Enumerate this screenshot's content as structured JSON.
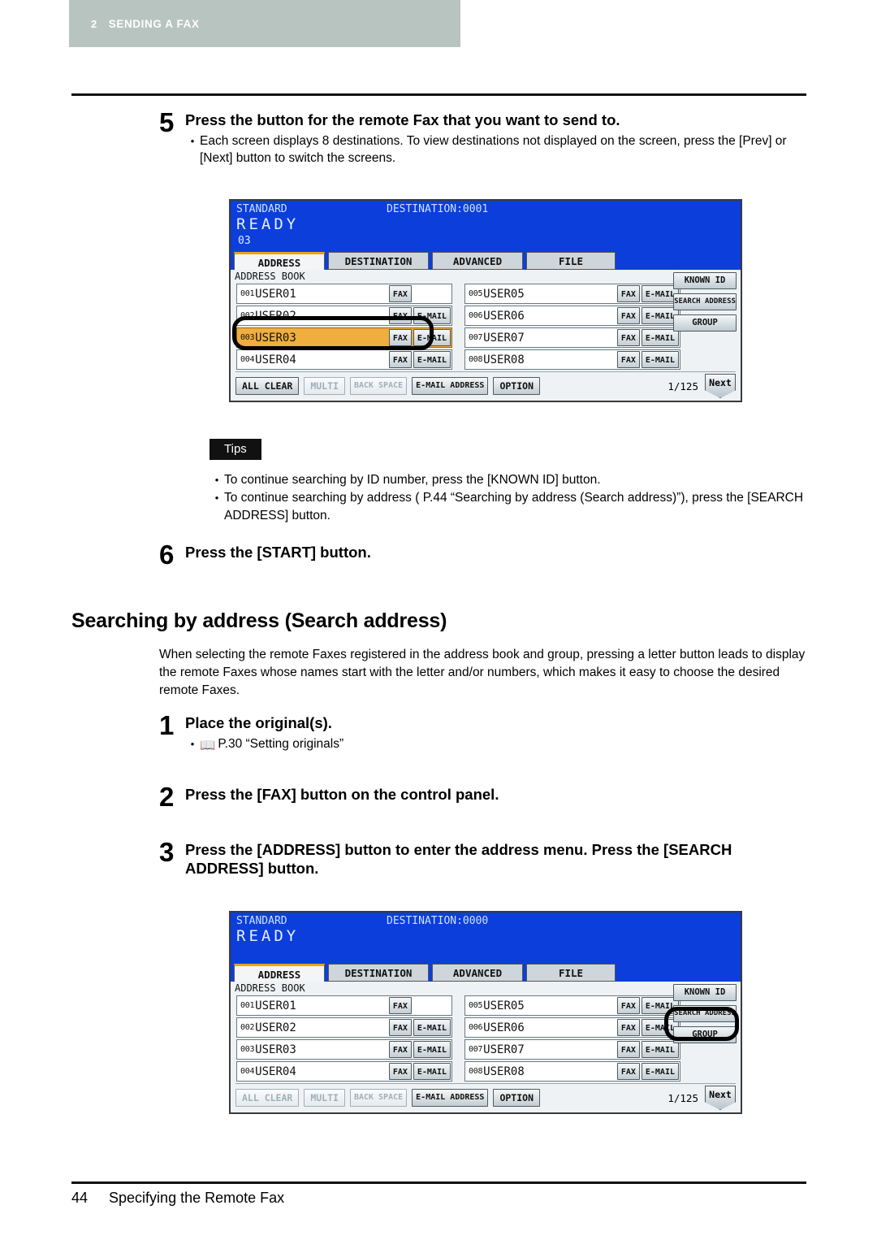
{
  "chapter": {
    "number": "2",
    "title": "SENDING A FAX"
  },
  "footer": {
    "page_number": "44",
    "text": "Specifying the Remote Fax"
  },
  "steps": {
    "step5": {
      "number": "5",
      "title": "Press the button for the remote Fax that you want to send to.",
      "bullet": "Each screen displays 8 destinations. To view destinations not displayed on the screen, press the [Prev] or [Next] button to switch the screens."
    },
    "step6": {
      "number": "6",
      "title": "Press the [START] button."
    },
    "step1": {
      "number": "1",
      "title": "Place the original(s).",
      "bullet": "P.30 “Setting originals”"
    },
    "step2": {
      "number": "2",
      "title": "Press the [FAX] button on the control panel."
    },
    "step3": {
      "number": "3",
      "title": "Press the [ADDRESS] button to enter the address menu. Press the [SEARCH ADDRESS] button."
    }
  },
  "tips": {
    "label": "Tips",
    "items": [
      "To continue searching by ID number, press the [KNOWN ID] button.",
      "To continue searching by address ( P.44 “Searching by address (Search address)”), press the [SEARCH ADDRESS] button."
    ]
  },
  "section": {
    "heading": "Searching by address (Search address)",
    "paragraph": "When selecting the remote Faxes registered in the address book and group, pressing a letter button leads to display the remote Faxes whose names start with the letter and/or numbers, which makes it easy to choose the desired remote Faxes."
  },
  "lcd1": {
    "status_mode": "STANDARD",
    "destination": "DESTINATION:0001",
    "ready": "READY",
    "sub_line": "03",
    "tabs": [
      "ADDRESS",
      "DESTINATION",
      "ADVANCED",
      "FILE"
    ],
    "active_tab": "ADDRESS",
    "address_book_label": "ADDRESS BOOK",
    "left_rows": [
      {
        "id": "001",
        "name": "USER01",
        "fax": "FAX",
        "email": ""
      },
      {
        "id": "002",
        "name": "USER02",
        "fax": "FAX",
        "email": "E-MAIL"
      },
      {
        "id": "003",
        "name": "USER03",
        "fax": "FAX",
        "email": "E-MAIL"
      },
      {
        "id": "004",
        "name": "USER04",
        "fax": "FAX",
        "email": "E-MAIL"
      }
    ],
    "right_rows": [
      {
        "id": "005",
        "name": "USER05",
        "fax": "FAX",
        "email": "E-MAIL"
      },
      {
        "id": "006",
        "name": "USER06",
        "fax": "FAX",
        "email": "E-MAIL"
      },
      {
        "id": "007",
        "name": "USER07",
        "fax": "FAX",
        "email": "E-MAIL"
      },
      {
        "id": "008",
        "name": "USER08",
        "fax": "FAX",
        "email": "E-MAIL"
      }
    ],
    "selected_row_index": 2,
    "side_buttons": [
      "KNOWN ID",
      "SEARCH ADDRESS",
      "GROUP"
    ],
    "bottom_buttons": [
      {
        "label": "ALL CLEAR",
        "disabled": false
      },
      {
        "label": "MULTI",
        "disabled": true
      },
      {
        "label": "BACK SPACE",
        "disabled": true
      },
      {
        "label": "E-MAIL ADDRESS",
        "disabled": false
      },
      {
        "label": "OPTION",
        "disabled": false
      }
    ],
    "page_count": "1/125",
    "next_label": "Next"
  },
  "lcd2": {
    "status_mode": "STANDARD",
    "destination": "DESTINATION:0000",
    "ready": "READY",
    "sub_line": "",
    "tabs": [
      "ADDRESS",
      "DESTINATION",
      "ADVANCED",
      "FILE"
    ],
    "active_tab": "ADDRESS",
    "address_book_label": "ADDRESS BOOK",
    "left_rows": [
      {
        "id": "001",
        "name": "USER01",
        "fax": "FAX",
        "email": ""
      },
      {
        "id": "002",
        "name": "USER02",
        "fax": "FAX",
        "email": "E-MAIL"
      },
      {
        "id": "003",
        "name": "USER03",
        "fax": "FAX",
        "email": "E-MAIL"
      },
      {
        "id": "004",
        "name": "USER04",
        "fax": "FAX",
        "email": "E-MAIL"
      }
    ],
    "right_rows": [
      {
        "id": "005",
        "name": "USER05",
        "fax": "FAX",
        "email": "E-MAIL"
      },
      {
        "id": "006",
        "name": "USER06",
        "fax": "FAX",
        "email": "E-MAIL"
      },
      {
        "id": "007",
        "name": "USER07",
        "fax": "FAX",
        "email": "E-MAIL"
      },
      {
        "id": "008",
        "name": "USER08",
        "fax": "FAX",
        "email": "E-MAIL"
      }
    ],
    "selected_row_index": -1,
    "side_buttons": [
      "KNOWN ID",
      "SEARCH ADDRESS",
      "GROUP"
    ],
    "highlighted_side_button": "SEARCH ADDRESS",
    "bottom_buttons": [
      {
        "label": "ALL CLEAR",
        "disabled": true
      },
      {
        "label": "MULTI",
        "disabled": true
      },
      {
        "label": "BACK SPACE",
        "disabled": true
      },
      {
        "label": "E-MAIL ADDRESS",
        "disabled": false
      },
      {
        "label": "OPTION",
        "disabled": false
      }
    ],
    "page_count": "1/125",
    "next_label": "Next"
  },
  "colors": {
    "chapter_bar": "#b8c4c0",
    "lcd_blue": "#0c3edb",
    "selection_orange": "#f0ae3e",
    "tab_accent": "#e8a21a"
  }
}
